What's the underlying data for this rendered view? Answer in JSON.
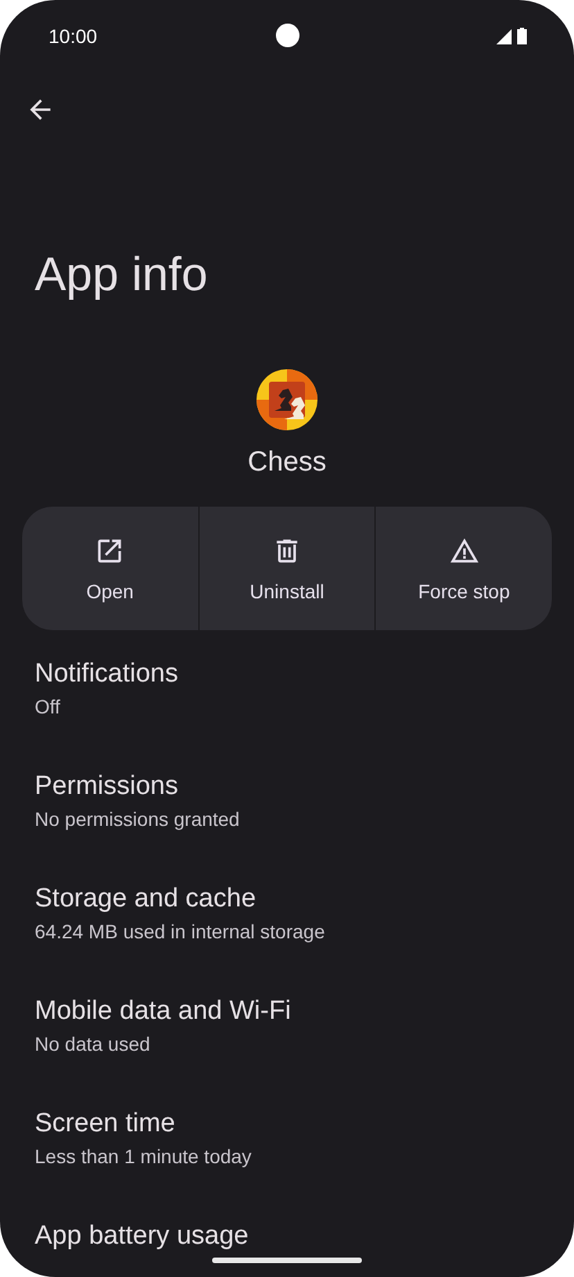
{
  "status_bar": {
    "time": "10:00"
  },
  "title": "App info",
  "app": {
    "name": "Chess"
  },
  "actions": [
    {
      "label": "Open",
      "kind": "open"
    },
    {
      "label": "Uninstall",
      "kind": "uninstall"
    },
    {
      "label": "Force stop",
      "kind": "stop"
    }
  ],
  "settings": [
    {
      "title": "Notifications",
      "summary": "Off"
    },
    {
      "title": "Permissions",
      "summary": "No permissions granted"
    },
    {
      "title": "Storage and cache",
      "summary": "64.24 MB used in internal storage"
    },
    {
      "title": "Mobile data and Wi-Fi",
      "summary": "No data used"
    },
    {
      "title": "Screen time",
      "summary": "Less than 1 minute today"
    },
    {
      "title": "App battery usage"
    }
  ]
}
